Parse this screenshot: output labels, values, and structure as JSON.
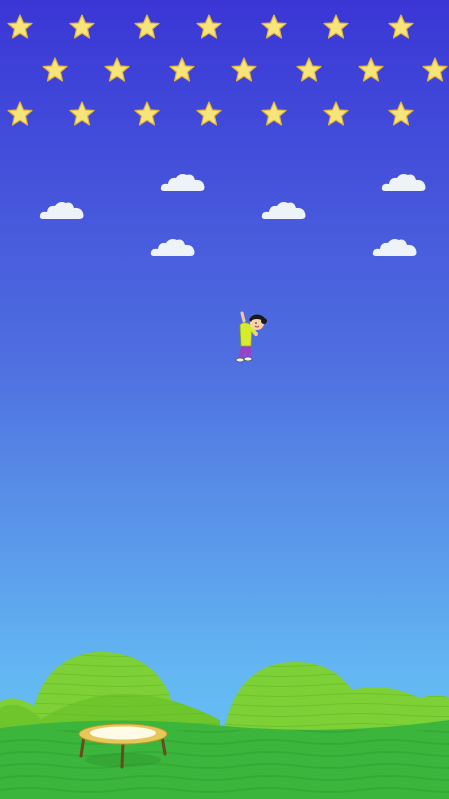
{
  "game": {
    "colors": {
      "sky_top": "#3a36d6",
      "sky_mid": "#4f6fe0",
      "sky_bottom": "#63b8f2",
      "star_fill": "#f7e47a",
      "star_stroke": "#e0b43a",
      "cloud": "#eef3f7",
      "hill_light": "#7ed037",
      "hill_dark": "#5fb522",
      "ground": "#3cb53c",
      "trampoline_frame": "#e6c85a",
      "trampoline_mat": "#fffbe6",
      "trampoline_legs": "#6b4a1f"
    },
    "stars": {
      "rows": 3,
      "icon": "star-icon"
    },
    "clouds": {
      "count": 6,
      "icon": "cloud-icon"
    },
    "player": {
      "icon": "jumping-kid-icon",
      "shirt_color": "#d7ec2e",
      "pants_color": "#9b3fc7",
      "hair_color": "#1a1a1a"
    },
    "trampoline": {
      "icon": "trampoline-icon"
    }
  }
}
